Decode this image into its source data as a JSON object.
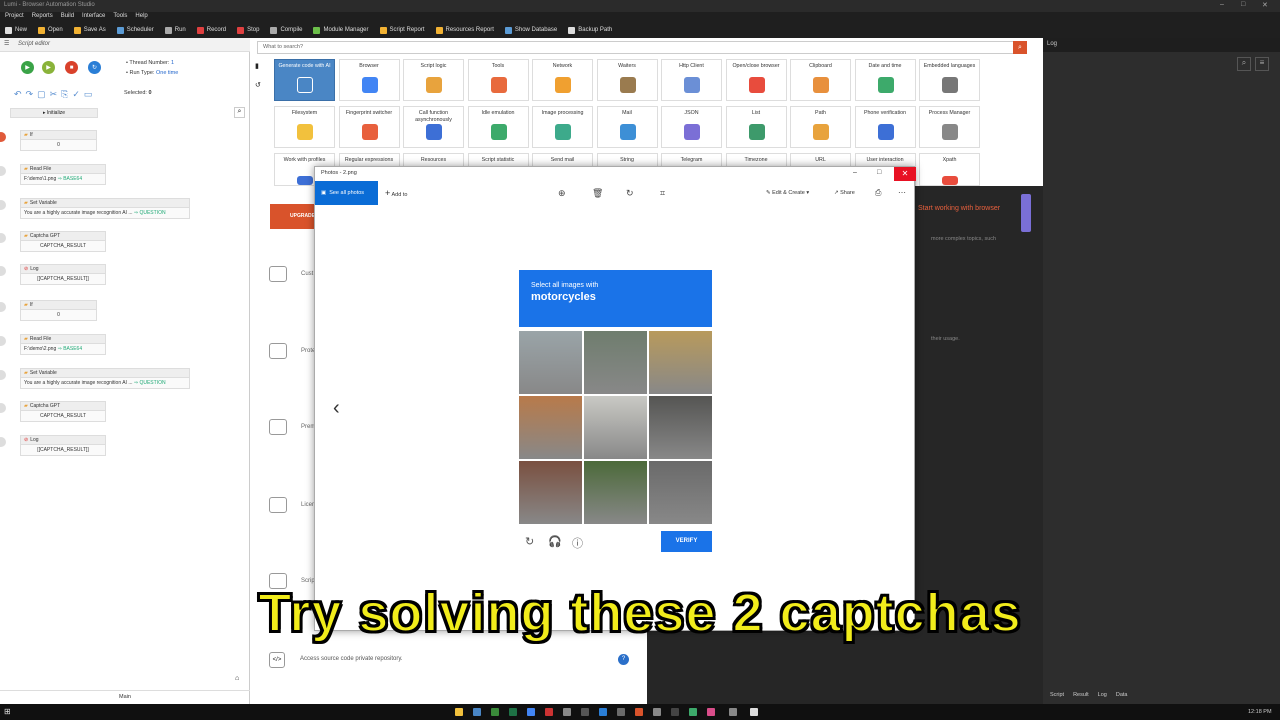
{
  "window": {
    "title": "Lumi - Browser Automation Studio"
  },
  "menu": [
    "Project",
    "Reports",
    "Build",
    "Interface",
    "Tools",
    "Help"
  ],
  "toolbar": [
    {
      "label": "New",
      "color": "#e0e0e0"
    },
    {
      "label": "Open",
      "color": "#f2b233"
    },
    {
      "label": "Save As",
      "color": "#f2b233"
    },
    {
      "label": "Scheduler",
      "color": "#5b9bd5"
    },
    {
      "label": "Run",
      "color": "#aaaaaa"
    },
    {
      "label": "Record",
      "color": "#e04040"
    },
    {
      "label": "Stop",
      "color": "#e04040"
    },
    {
      "label": "Compile",
      "color": "#aaaaaa"
    },
    {
      "label": "Module Manager",
      "color": "#6cbf4a"
    },
    {
      "label": "Script Report",
      "color": "#f2b233"
    },
    {
      "label": "Resources Report",
      "color": "#f2b233"
    },
    {
      "label": "Show Database",
      "color": "#5b9bd5"
    },
    {
      "label": "Backup Path",
      "color": "#dddddd"
    }
  ],
  "editor": {
    "title": "Script editor",
    "thread_label": "Thread Number:",
    "thread_value": "1",
    "runtype_label": "Run Type:",
    "runtype_value": "One time",
    "selected_label": "Selected:",
    "selected_value": "0",
    "initialize": "Initialize",
    "footer": "Main",
    "blocks": [
      {
        "title": "If",
        "body": "0"
      },
      {
        "title": "Read File",
        "body": "F:\\demo\\1.png",
        "tag": "BASE64"
      },
      {
        "title": "Set Variable",
        "body": "You are a highly accurate image recognition AI ...",
        "tag": "QUESTION"
      },
      {
        "title": "Captcha GPT",
        "body": "CAPTCHA_RESULT"
      },
      {
        "title": "Log",
        "body": "[[CAPTCHA_RESULT]]"
      },
      {
        "title": "If",
        "body": "0"
      },
      {
        "title": "Read File",
        "body": "F:\\demo\\2.png",
        "tag": "BASE64"
      },
      {
        "title": "Set Variable",
        "body": "You are a highly accurate image recognition AI ...",
        "tag": "QUESTION"
      },
      {
        "title": "Captcha GPT",
        "body": "CAPTCHA_RESULT"
      },
      {
        "title": "Log",
        "body": "[[CAPTCHA_RESULT]]"
      }
    ]
  },
  "actions": {
    "search_placeholder": "What to search?",
    "tiles": [
      {
        "label": "Generate code with AI",
        "color": "#ffffff"
      },
      {
        "label": "Browser",
        "color": "#4285f4"
      },
      {
        "label": "Script logic",
        "color": "#e8a33d"
      },
      {
        "label": "Tools",
        "color": "#e86a3d"
      },
      {
        "label": "Network",
        "color": "#f0a030"
      },
      {
        "label": "Waiters",
        "color": "#9a7b4f"
      },
      {
        "label": "Http Client",
        "color": "#6b8fd6"
      },
      {
        "label": "Open/close browser",
        "color": "#e84c3d"
      },
      {
        "label": "Clipboard",
        "color": "#e8903d"
      },
      {
        "label": "Date and time",
        "color": "#3daa6b"
      },
      {
        "label": "Embedded languages",
        "color": "#777777"
      },
      {
        "label": "Filesystem",
        "color": "#f2c13d"
      },
      {
        "label": "Fingerprint switcher",
        "color": "#e8603d"
      },
      {
        "label": "Call function asynchronously",
        "color": "#3d6fd6"
      },
      {
        "label": "Idle emulation",
        "color": "#3daa6b"
      },
      {
        "label": "Image processing",
        "color": "#3daa8b"
      },
      {
        "label": "Mail",
        "color": "#3d8fd6"
      },
      {
        "label": "JSON",
        "color": "#7b6fd6"
      },
      {
        "label": "List",
        "color": "#3d9a6b"
      },
      {
        "label": "Path",
        "color": "#e8a33d"
      },
      {
        "label": "Phone verification",
        "color": "#3d6fd6"
      },
      {
        "label": "Process Manager",
        "color": "#888888"
      },
      {
        "label": "Work with profiles",
        "color": "#3d6fd6"
      },
      {
        "label": "Regular expressions",
        "color": "#e86a3d"
      },
      {
        "label": "Resources",
        "color": "#999999"
      },
      {
        "label": "Script statistic",
        "color": "#3d8fd6"
      },
      {
        "label": "Send mail",
        "color": "#e8a33d"
      },
      {
        "label": "String",
        "color": "#e86a3d"
      },
      {
        "label": "Telegram",
        "color": "#3d9ad6"
      },
      {
        "label": "Timezone",
        "color": "#3daa6b"
      },
      {
        "label": "URL",
        "color": "#7b6fd6"
      },
      {
        "label": "User interaction",
        "color": "#e8603d"
      },
      {
        "label": "Xpath",
        "color": "#e84c3d"
      }
    ]
  },
  "background_page": {
    "upgrade": "UPGRADE",
    "items": [
      "Cust",
      "Prote",
      "Prem",
      "Licen",
      "Scrip"
    ],
    "repo_text": "Access source code private repository.",
    "start_link": "Start working with browser",
    "line1": "more complex topics, such",
    "line2": "their usage."
  },
  "photos": {
    "title": "Photos - 2.png",
    "see_all": "See all photos",
    "add_to": "Add to",
    "edit_create": "Edit & Create",
    "share": "Share",
    "captcha": {
      "prompt": "Select all images with",
      "target": "motorcycles",
      "verify": "VERIFY",
      "cells": [
        "#9aa4a8",
        "#6f7d6e",
        "#b89a5c",
        "#b87a4a",
        "#c9c9c4",
        "#555553",
        "#7a5040",
        "#4c6a3a",
        "#6a6a6a"
      ]
    }
  },
  "log": {
    "title": "Log",
    "tabs": [
      "Script",
      "Result",
      "Log",
      "Data"
    ]
  },
  "subtitle": "Try solving these 2 captchas",
  "taskbar": {
    "time": "12:18 PM"
  }
}
